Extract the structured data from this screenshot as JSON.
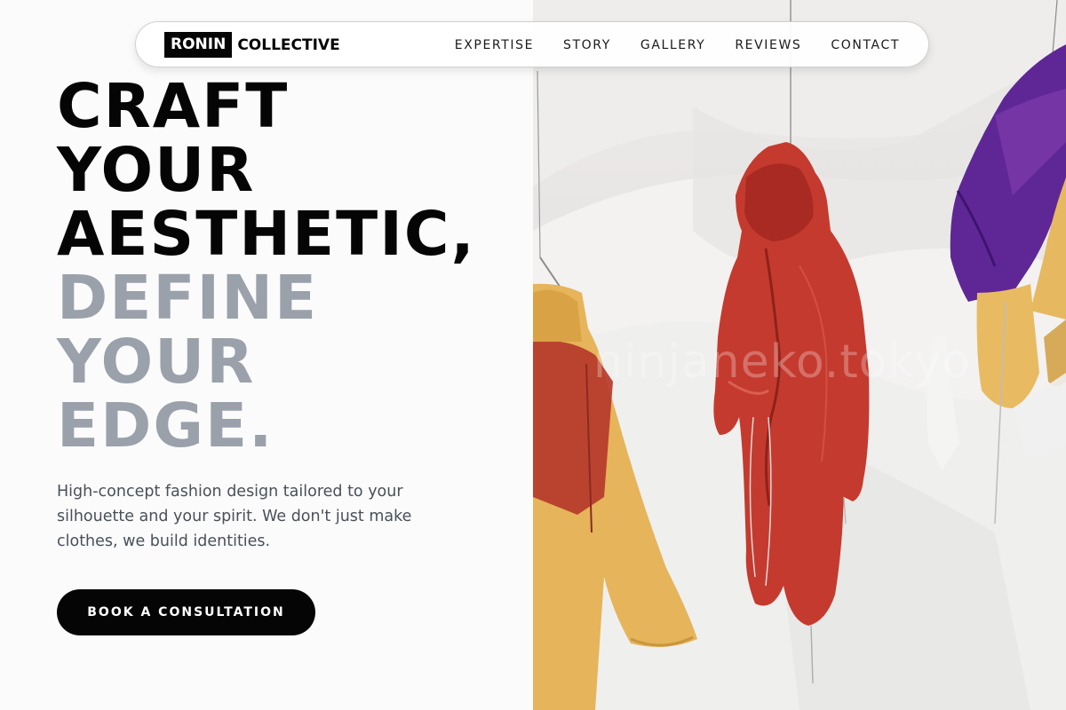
{
  "brand": {
    "mark": "RONIN",
    "name": "COLLECTIVE"
  },
  "nav": {
    "items": [
      {
        "label": "EXPERTISE"
      },
      {
        "label": "STORY"
      },
      {
        "label": "GALLERY"
      },
      {
        "label": "REVIEWS"
      },
      {
        "label": "CONTACT"
      }
    ]
  },
  "hero": {
    "headline_dark": [
      "CRAFT",
      "YOUR",
      "AESTHETIC,"
    ],
    "headline_muted": [
      "DEFINE",
      "YOUR",
      "EDGE."
    ],
    "subtext": "High-concept fashion design tailored to your silhouette and your spirit. We don't just make clothes, we build identities.",
    "cta_label": "BOOK A CONSULTATION",
    "photo_watermark": "ninjaneko.tokyo"
  },
  "colors": {
    "text_dark": "#050505",
    "text_muted": "#9aa1ab",
    "body_text": "#4a5059",
    "cta_bg": "#050505"
  }
}
